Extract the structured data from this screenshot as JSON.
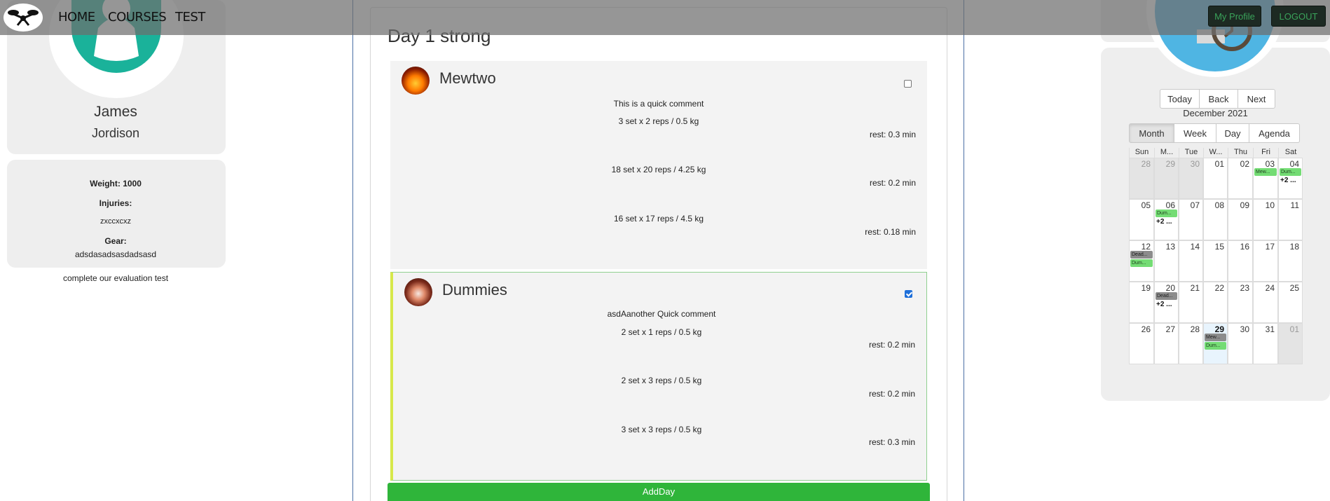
{
  "nav": {
    "links": [
      "HOME",
      "COURSES",
      "TEST"
    ],
    "profile_button": "My Profile",
    "logout_button": "LOGOUT"
  },
  "profile": {
    "first_name": "James",
    "last_name": "Jordison",
    "weight": "Weight: 1000",
    "injuries_label": "Injuries:",
    "injuries_value": "zxccxcxz",
    "gear_label": "Gear:",
    "gear_value": "adsdasadsasdadsasd",
    "note": "complete our evaluation test"
  },
  "day": {
    "title": "Day 1 strong",
    "add_button": "AddDay",
    "exercises": [
      {
        "name": "Mewtwo",
        "comment": "This is a quick comment",
        "checked": false,
        "sets": [
          {
            "desc": "3 set x 2 reps / 0.5 kg",
            "rest": "rest: 0.3 min"
          },
          {
            "desc": "18 set x 20 reps / 4.25 kg",
            "rest": "rest: 0.2 min"
          },
          {
            "desc": "16 set x 17 reps / 4.5 kg",
            "rest": "rest: 0.18 min"
          }
        ]
      },
      {
        "name": "Dummies",
        "comment": "asdAanother Quick comment",
        "checked": true,
        "sets": [
          {
            "desc": "2 set x 1 reps / 0.5 kg",
            "rest": "rest: 0.2 min"
          },
          {
            "desc": "2 set x 3 reps / 0.5 kg",
            "rest": "rest: 0.2 min"
          },
          {
            "desc": "3 set x 3 reps / 0.5 kg",
            "rest": "rest: 0.3 min"
          }
        ]
      }
    ]
  },
  "calendar": {
    "nav_buttons": [
      "Today",
      "Back",
      "Next"
    ],
    "label": "December 2021",
    "views": [
      "Month",
      "Week",
      "Day",
      "Agenda"
    ],
    "active_view": "Month",
    "weekdays": [
      "Sun",
      "M...",
      "Tue",
      "W...",
      "Thu",
      "Fri",
      "Sat"
    ],
    "weeks": [
      [
        "28",
        "29",
        "30",
        "01",
        "02",
        "03",
        "04"
      ],
      [
        "05",
        "06",
        "07",
        "08",
        "09",
        "10",
        "11"
      ],
      [
        "12",
        "13",
        "14",
        "15",
        "16",
        "17",
        "18"
      ],
      [
        "19",
        "20",
        "21",
        "22",
        "23",
        "24",
        "25"
      ],
      [
        "26",
        "27",
        "28",
        "29",
        "30",
        "31",
        "01"
      ]
    ],
    "events": {
      "mew": "Mew...",
      "dum": "Dum...",
      "dead": "Dead...",
      "more": "+2 ..."
    }
  },
  "colors": {
    "add_button": "#2fb53a",
    "event_green": "#74dc74",
    "event_gray": "#8c8c8c",
    "avatar_teal": "#1ab29a",
    "calendar_blue": "#4fb5e3"
  }
}
